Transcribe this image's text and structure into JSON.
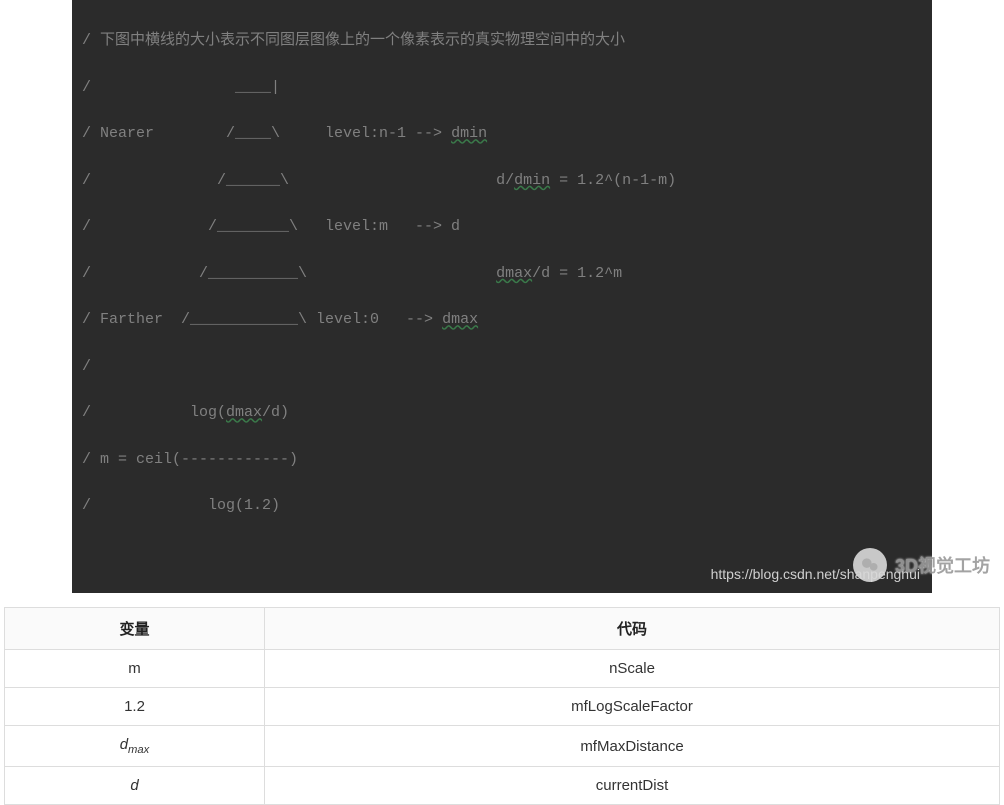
{
  "code": {
    "title_line": "/ 下图中横线的大小表示不同图层图像上的一个像素表示的真实物理空间中的大小",
    "lines": [
      "/                ____|",
      "/ Nearer        /____\\     level:n-1 --> dmin",
      "/              /______\\                       d/dmin = 1.2^(n-1-m)",
      "/             /________\\   level:m   --> d",
      "/            /__________\\                     dmax/d = 1.2^m",
      "/ Farther  /____________\\ level:0   --> dmax",
      "/",
      "/           log(dmax/d)",
      "/ m = ceil(------------)",
      "/             log(1.2)"
    ],
    "url_watermark": "https://blog.csdn.net/shanpenghui"
  },
  "table": {
    "headers": [
      "变量",
      "代码"
    ],
    "rows": [
      {
        "var": "m",
        "code": "nScale"
      },
      {
        "var": "1.2",
        "code": "mfLogScaleFactor"
      },
      {
        "var_html": "d<sub>max</sub>",
        "code": "mfMaxDistance"
      },
      {
        "var_html": "d",
        "code": "currentDist"
      }
    ]
  },
  "watermark": {
    "text": "3D视觉工坊",
    "icon": "wechat-icon"
  }
}
